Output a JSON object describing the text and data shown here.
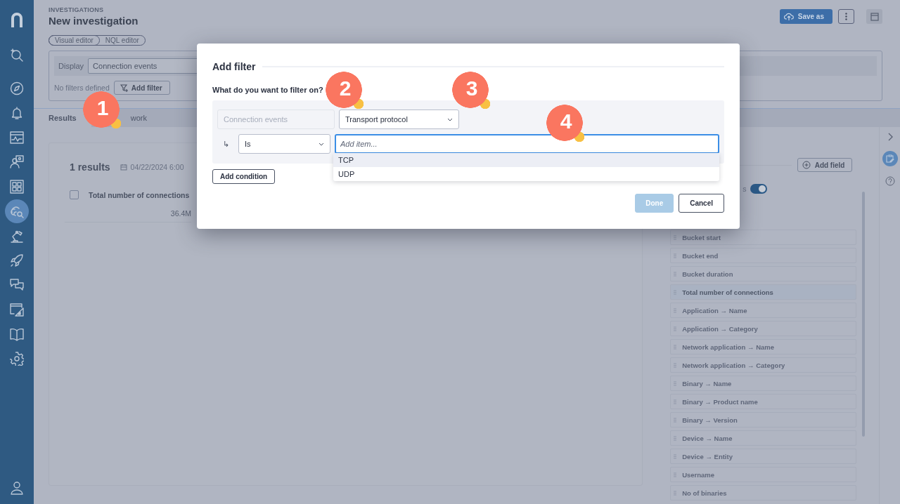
{
  "sidebar": {
    "items": [
      {
        "selected": false
      },
      {
        "selected": false
      },
      {
        "selected": false
      },
      {
        "selected": false
      },
      {
        "selected": false
      },
      {
        "selected": false
      },
      {
        "selected": false
      },
      {
        "selected": true
      },
      {
        "selected": false
      },
      {
        "selected": false
      },
      {
        "selected": false
      },
      {
        "selected": false
      },
      {
        "selected": false
      },
      {
        "selected": false
      },
      {
        "selected": false
      }
    ]
  },
  "header": {
    "breadcrumb": "INVESTIGATIONS",
    "title": "New investigation",
    "save_button": "Save as"
  },
  "editor_modes": [
    {
      "label": "Visual editor",
      "selected": true
    },
    {
      "label": "NQL editor",
      "selected": false
    }
  ],
  "query": {
    "display_label": "Display",
    "display_value": "Connection events",
    "filters_status": "No filters defined",
    "add_filter": "Add filter"
  },
  "tabs": [
    {
      "label": "Results",
      "selected": true
    },
    {
      "label": "work",
      "selected": false
    }
  ],
  "results": {
    "count": "1 results",
    "date": "04/22/2024 6:00",
    "column": {
      "label": "Total number of connections",
      "checked": false
    },
    "value": "36.4M"
  },
  "fields_panel": {
    "add_field": "Add field",
    "toggle_label": "s",
    "toggle_on": true,
    "fields": [
      {
        "label": "Bucket start",
        "selected": false
      },
      {
        "label": "Bucket end",
        "selected": false
      },
      {
        "label": "Bucket duration",
        "selected": false
      },
      {
        "label": "Total number of connections",
        "selected": true
      },
      {
        "label": "Application → Name",
        "selected": false
      },
      {
        "label": "Application → Category",
        "selected": false
      },
      {
        "label": "Network application → Name",
        "selected": false
      },
      {
        "label": "Network application → Category",
        "selected": false
      },
      {
        "label": "Binary → Name",
        "selected": false
      },
      {
        "label": "Binary → Product name",
        "selected": false
      },
      {
        "label": "Binary → Version",
        "selected": false
      },
      {
        "label": "Device → Name",
        "selected": false
      },
      {
        "label": "Device → Entity",
        "selected": false
      },
      {
        "label": "Username",
        "selected": false
      },
      {
        "label": "No of binaries",
        "selected": false
      }
    ]
  },
  "modal": {
    "title": "Add filter",
    "question": "What do you want to filter on?",
    "source": {
      "value": "Connection events",
      "disabled": true
    },
    "field": {
      "value": "Transport protocol"
    },
    "operator": {
      "value": "Is"
    },
    "condition_arrow": "↳",
    "item_input": {
      "placeholder": "Add item..."
    },
    "options": [
      {
        "label": "TCP",
        "selected": true
      },
      {
        "label": "UDP",
        "selected": false
      }
    ],
    "add_condition": "Add condition",
    "buttons": [
      {
        "label": "Done",
        "disabled": true
      },
      {
        "label": "Cancel",
        "disabled": false
      }
    ]
  },
  "callouts": [
    {
      "label": "1"
    },
    {
      "label": "2"
    },
    {
      "label": "3"
    },
    {
      "label": "4"
    }
  ]
}
